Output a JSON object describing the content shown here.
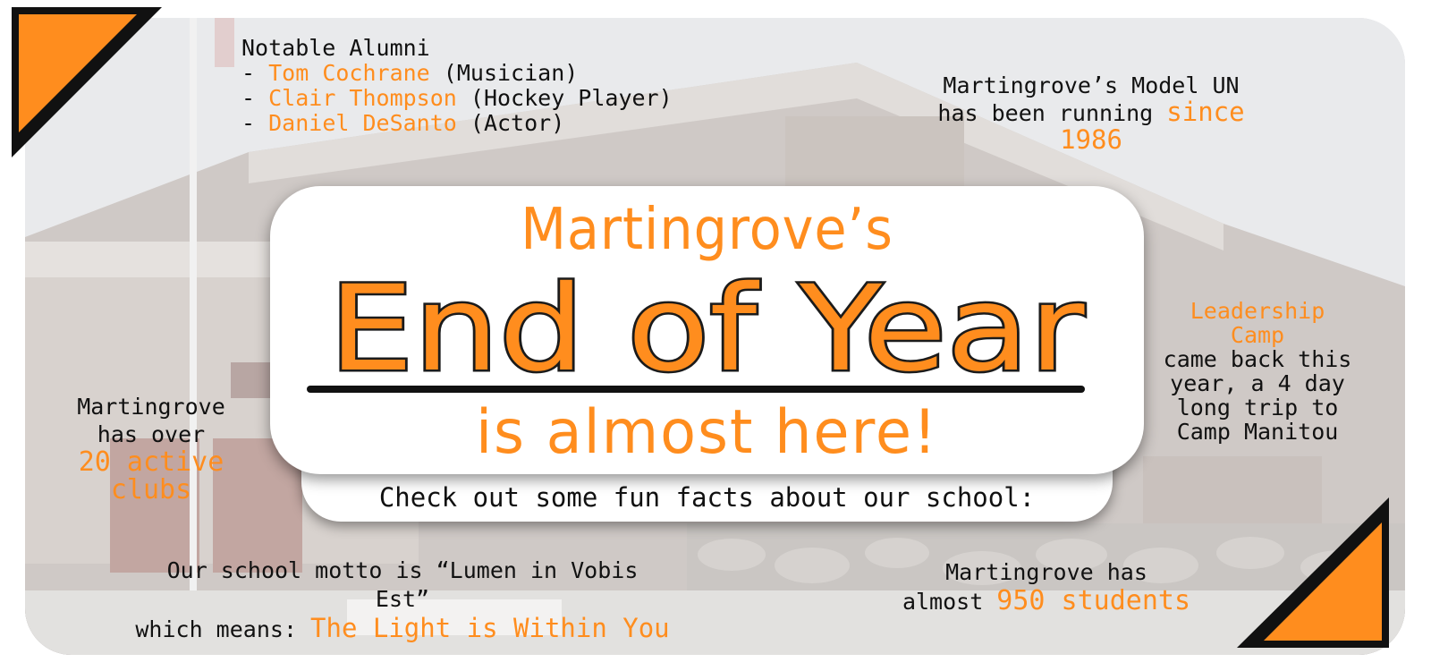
{
  "alumni": {
    "heading": "Notable Alumni",
    "people": [
      {
        "name": "Tom Cochrane",
        "role": "Musician"
      },
      {
        "name": "Clair Thompson",
        "role": "Hockey Player"
      },
      {
        "name": "Daniel DeSanto",
        "role": "Actor"
      }
    ]
  },
  "model_un": {
    "line1": "Martingrove’s Model UN",
    "line2_prefix": "has been running ",
    "highlight": "since 1986"
  },
  "leadership": {
    "highlight": "Leadership Camp",
    "lines": [
      "came back this",
      "year, a 4 day",
      "long trip to",
      "Camp Manitou"
    ]
  },
  "clubs": {
    "line1": "Martingrove",
    "line2": "has over",
    "highlight": "20 active clubs"
  },
  "motto": {
    "line1": "Our school motto is “Lumen in Vobis Est”",
    "line2_prefix": "which means: ",
    "highlight": "The Light is Within You"
  },
  "students": {
    "line1": "Martingrove has",
    "line2_prefix": "almost ",
    "highlight": "950 students"
  },
  "banner": {
    "school_name": "Martingrove’s",
    "headline": "End of Year",
    "subline": "is almost here!",
    "facts_intro": "Check out some fun facts about our school:"
  },
  "colors": {
    "accent": "#ff8d1e",
    "text": "#111111",
    "card": "#ffffff"
  }
}
